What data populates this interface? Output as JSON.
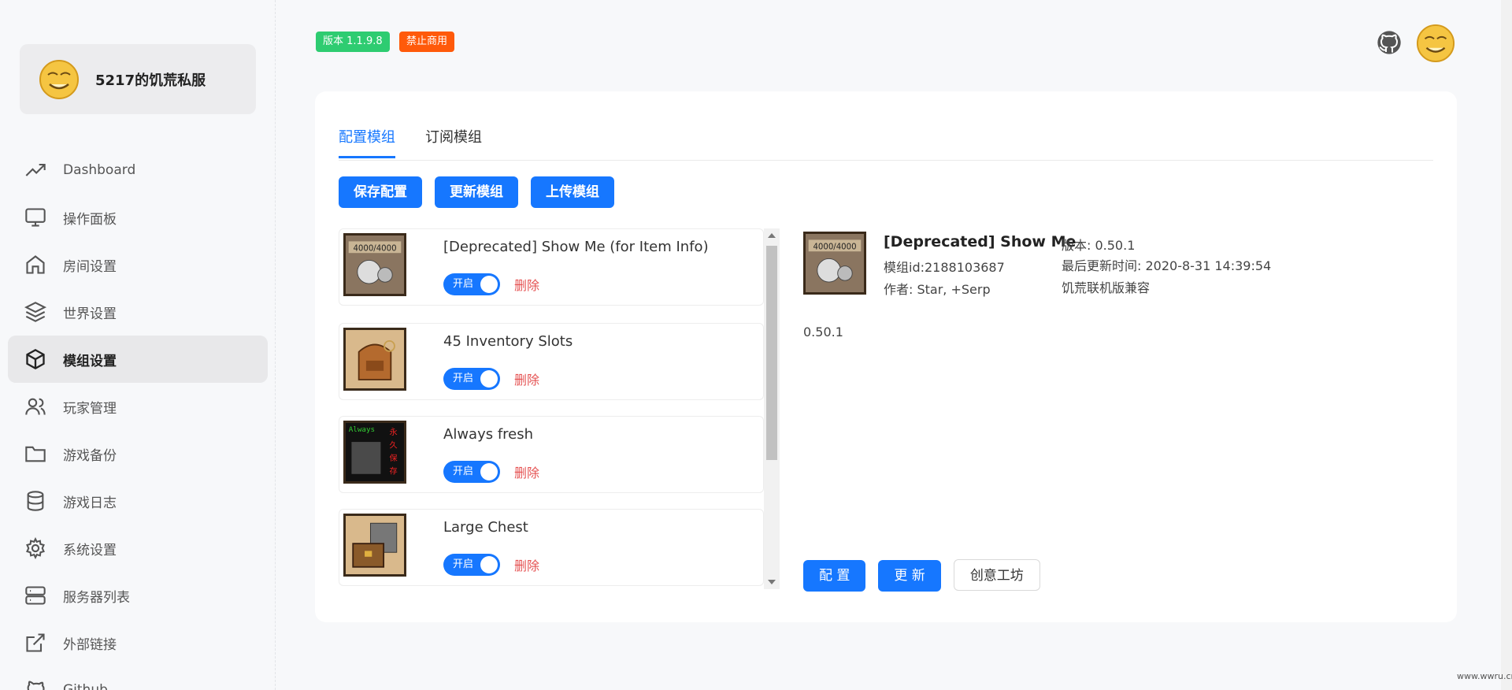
{
  "brand": {
    "name": "5217的饥荒私服"
  },
  "sidebar": {
    "items": [
      {
        "label": "Dashboard",
        "icon": "trending-up-icon"
      },
      {
        "label": "操作面板",
        "icon": "monitor-icon"
      },
      {
        "label": "房间设置",
        "icon": "home-icon"
      },
      {
        "label": "世界设置",
        "icon": "layers-icon"
      },
      {
        "label": "模组设置",
        "icon": "cube-icon",
        "active": true
      },
      {
        "label": "玩家管理",
        "icon": "users-icon"
      },
      {
        "label": "游戏备份",
        "icon": "folder-icon"
      },
      {
        "label": "游戏日志",
        "icon": "database-icon"
      },
      {
        "label": "系统设置",
        "icon": "gear-icon"
      },
      {
        "label": "服务器列表",
        "icon": "server-icon"
      },
      {
        "label": "外部链接",
        "icon": "external-link-icon"
      },
      {
        "label": "Github",
        "icon": "github-icon"
      }
    ]
  },
  "header": {
    "version_badge": "版本 1.1.9.8",
    "commercial_badge": "禁止商用"
  },
  "tabs": {
    "config": "配置模组",
    "subscribe": "订阅模组"
  },
  "toolbar": {
    "save": "保存配置",
    "update": "更新模组",
    "upload": "上传模组"
  },
  "mods": [
    {
      "title": "[Deprecated] Show Me (for Item Info)",
      "toggle": "开启",
      "delete": "删除"
    },
    {
      "title": "45 Inventory Slots",
      "toggle": "开启",
      "delete": "删除"
    },
    {
      "title": "Always fresh",
      "toggle": "开启",
      "delete": "删除"
    },
    {
      "title": "Large Chest",
      "toggle": "开启",
      "delete": "删除"
    }
  ],
  "detail": {
    "name": "[Deprecated] Show Me",
    "mod_id": "模组id:2188103687",
    "author": "作者: Star, +Serp",
    "version": "版本: 0.50.1",
    "last_update": "最后更新时间: 2020-8-31 14:39:54",
    "compat": "饥荒联机版兼容",
    "body_version": "0.50.1",
    "btn_config": "配 置",
    "btn_update": "更 新",
    "btn_workshop": "创意工坊"
  },
  "colors": {
    "primary": "#1677ff",
    "danger": "#e55353",
    "success": "#2ecc71",
    "warning": "#ff5a0a"
  },
  "watermark": "www.wwru.cn"
}
